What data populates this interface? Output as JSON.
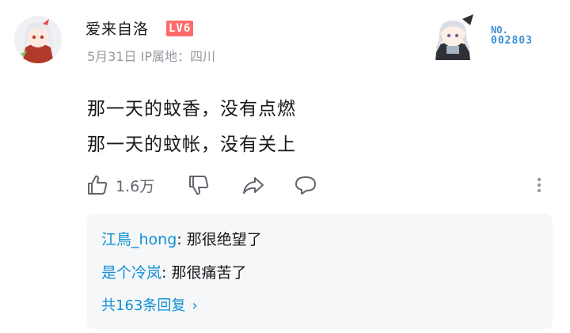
{
  "comment": {
    "username": "爱来自洛",
    "level": "LV6",
    "date": "5月31日",
    "ip_location": "IP属地：四川",
    "lines": [
      "那一天的蚊香，没有点燃",
      "那一天的蚊帐，没有关上"
    ]
  },
  "fan_badge": {
    "prefix": "NO.",
    "number": "002803"
  },
  "actions": {
    "like_count": "1.6万"
  },
  "replies": {
    "items": [
      {
        "user": "江鳥_hong",
        "text": ": 那很绝望了"
      },
      {
        "user": "是个冷岚",
        "text": ": 那很痛苦了"
      }
    ],
    "total_label": "共163条回复",
    "chevron": "›"
  },
  "colors": {
    "accent": "#0e8fd6",
    "level_badge": "#ff6b6b",
    "muted": "#9499a0",
    "reply_bg": "#f6f7f8"
  }
}
